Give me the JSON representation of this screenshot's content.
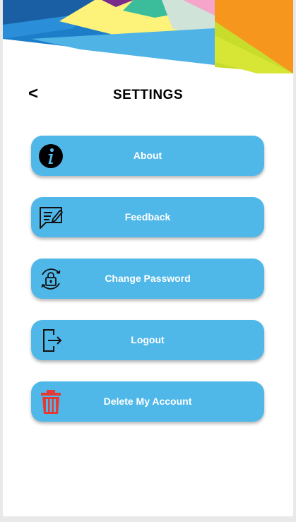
{
  "header": {
    "back_icon": "chevron-left-icon",
    "back_glyph": "<",
    "title": "SETTINGS"
  },
  "menu": [
    {
      "label": "About",
      "icon": "info-icon"
    },
    {
      "label": "Feedback",
      "icon": "feedback-icon"
    },
    {
      "label": "Change Password",
      "icon": "lock-refresh-icon"
    },
    {
      "label": "Logout",
      "icon": "logout-icon"
    },
    {
      "label": "Delete My Account",
      "icon": "trash-icon"
    }
  ],
  "colors": {
    "button_bg": "#50b8e8",
    "button_text": "#ffffff",
    "delete_icon": "#e53935",
    "banner": [
      "#1c7ec9",
      "#fdf27a",
      "#f7961d",
      "#c7dc2b",
      "#7b2b8a",
      "#3bbd9c"
    ]
  }
}
